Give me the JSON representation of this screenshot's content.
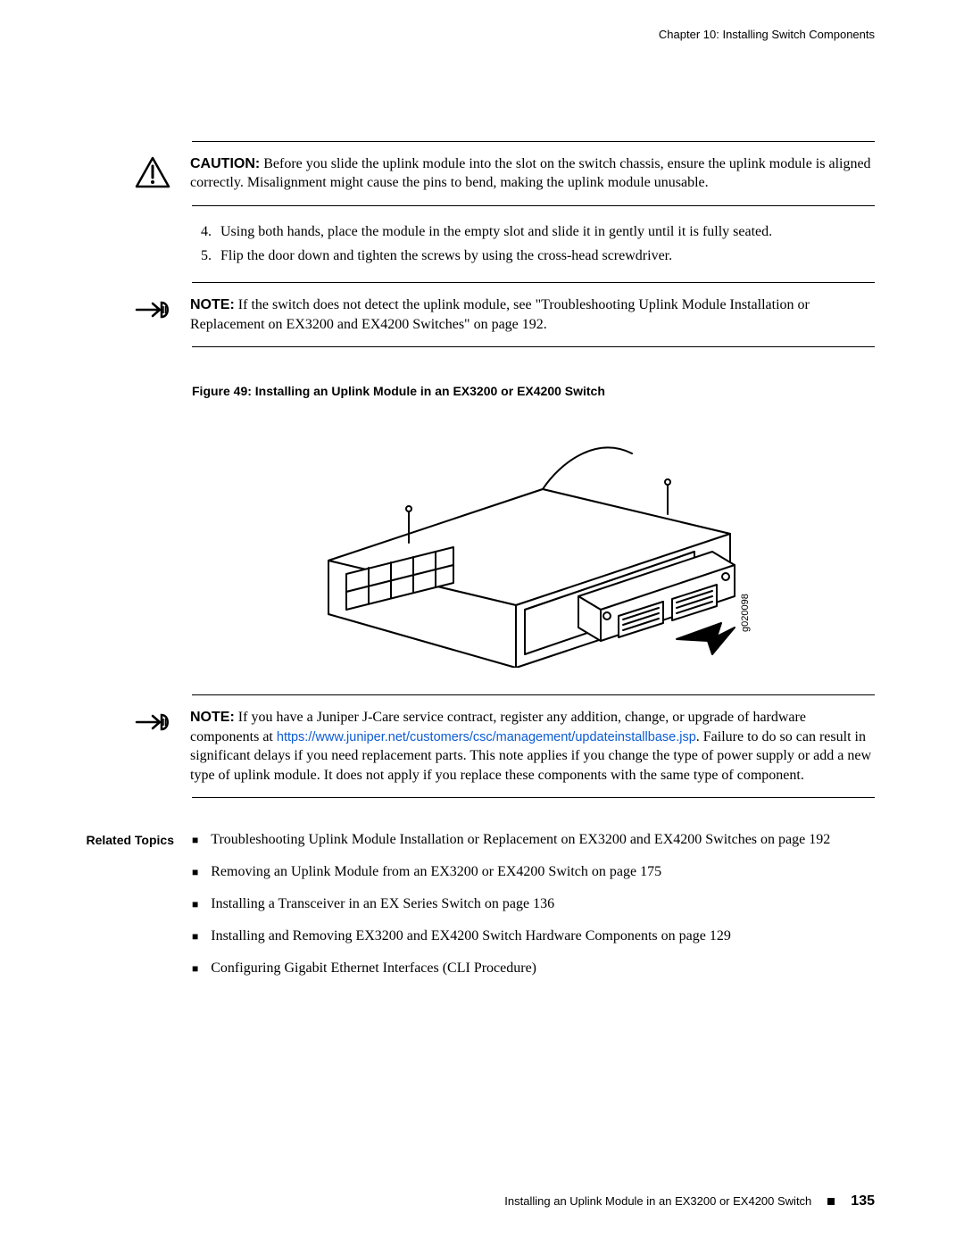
{
  "header": {
    "running": "Chapter 10: Installing Switch Components"
  },
  "caution": {
    "label": "CAUTION:",
    "text": "Before you slide the uplink module into the slot on the switch chassis, ensure the uplink module is aligned correctly. Misalignment might cause the pins to bend, making the uplink module unusable."
  },
  "steps": [
    {
      "num": "4.",
      "text": "Using both hands, place the module in the empty slot and slide it in gently until it is fully seated."
    },
    {
      "num": "5.",
      "text": "Flip the door down and tighten the screws by using the cross-head screwdriver."
    }
  ],
  "note1": {
    "label": "NOTE:",
    "text": "If the switch does not detect the uplink module, see \"Troubleshooting Uplink Module Installation or Replacement on EX3200 and EX4200 Switches\" on page 192."
  },
  "figure": {
    "caption": "Figure 49: Installing an Uplink Module in an EX3200 or EX4200 Switch",
    "image_id_label": "g020098"
  },
  "note2": {
    "label": "NOTE:",
    "before_link": "If you have a Juniper J-Care service contract, register any addition, change, or upgrade of hardware components at ",
    "link_text": "https://www.juniper.net/customers/csc/management/updateinstallbase.jsp",
    "after_link": ". Failure to do so can result in significant delays if you need replacement parts. This note applies if you change the type of power supply or add a new type of uplink module. It does not apply if you replace these components with the same type of component."
  },
  "related": {
    "label": "Related Topics",
    "items": [
      "Troubleshooting Uplink Module Installation or Replacement on EX3200 and EX4200 Switches on page 192",
      "Removing an Uplink Module from an EX3200 or EX4200 Switch on page 175",
      "Installing a Transceiver in an EX Series Switch on page 136",
      "Installing and Removing EX3200 and EX4200 Switch Hardware Components on page 129",
      "Configuring Gigabit Ethernet Interfaces (CLI Procedure)"
    ]
  },
  "footer": {
    "title": "Installing an Uplink Module in an EX3200 or EX4200 Switch",
    "page": "135"
  }
}
